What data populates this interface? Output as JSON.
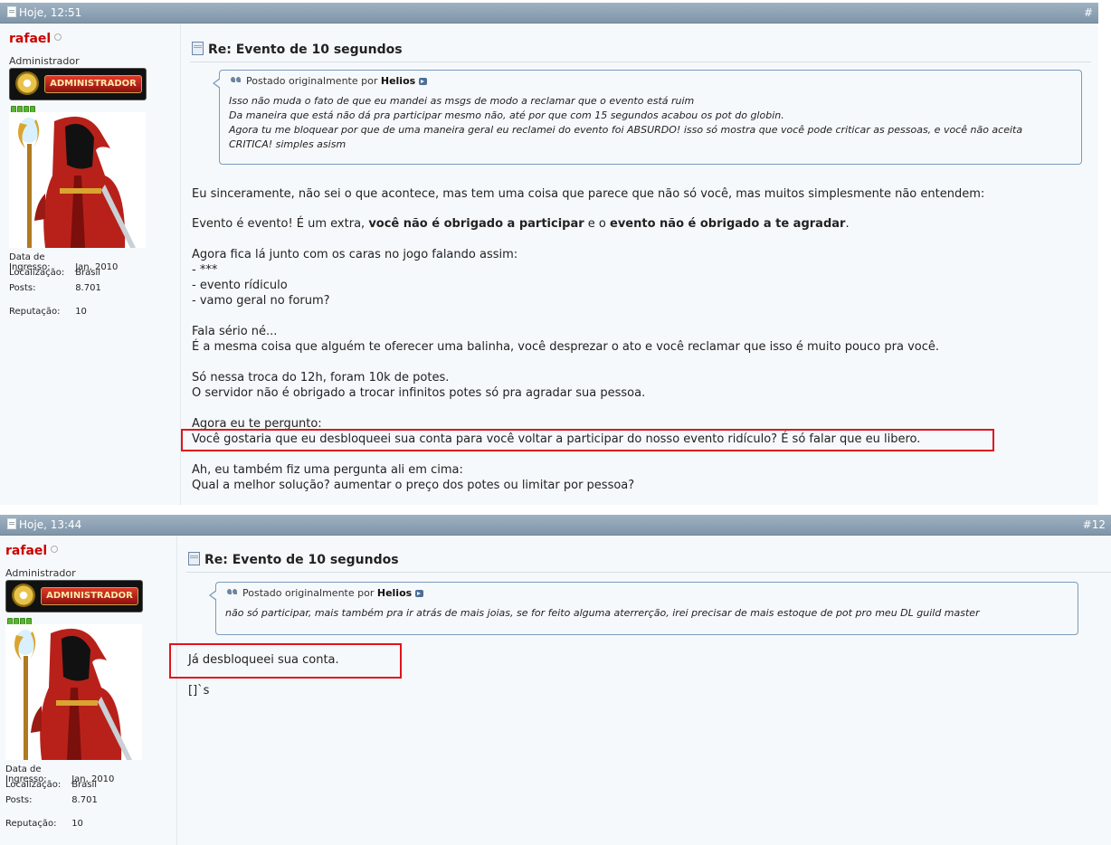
{
  "posts": [
    {
      "header": {
        "date": "Hoje, 12:51",
        "number": "#"
      },
      "user": {
        "name": "rafael",
        "title": "Administrador",
        "rank_label": "ADMINISTRADOR",
        "info": [
          {
            "key": "Data de Ingresso:",
            "value": "Jan, 2010"
          },
          {
            "key": "Localização:",
            "value": "Brasil"
          },
          {
            "key": "Posts:",
            "value": "8.701"
          },
          {
            "key": "Reputação:",
            "value": "10"
          }
        ]
      },
      "title": "Re: Evento de 10 segundos",
      "quote": {
        "prefix": "Postado originalmente por",
        "author": "Helios",
        "lines": [
          "Isso não muda o fato de que eu mandei as msgs de modo a reclamar que o evento está ruim",
          "Da maneira que está não dá pra participar mesmo não, até por que com 15 segundos acabou os pot do globin.",
          "Agora tu me bloquear por que de uma maneira geral eu reclamei do evento foi ABSURDO! isso só mostra que você pode criticar as pessoas, e você não aceita",
          "CRITICA! simples asism"
        ]
      },
      "body": {
        "p1": "Eu sinceramente, não sei o que acontece, mas tem uma coisa que parece que não só você, mas muitos simplesmente não entendem:",
        "p2a": "Evento é evento! É um extra, ",
        "p2b": "você não é obrigado a participar",
        "p2c": " e o ",
        "p2d": "evento não é obrigado a te agradar",
        "p2e": ".",
        "p3": [
          "Agora fica lá junto com os caras no jogo falando assim:",
          "- ***",
          "- evento rídiculo",
          "- vamo geral no forum?"
        ],
        "p4": [
          "Fala sério né...",
          "É a mesma coisa que alguém te oferecer uma balinha, você desprezar o ato e você reclamar que isso é muito pouco pra você."
        ],
        "p5": [
          "Só nessa troca do 12h, foram 10k de potes.",
          "O servidor não é obrigado a trocar infinitos potes só pra agradar sua pessoa."
        ],
        "p6": [
          "Agora eu te pergunto:",
          "Você gostaria que eu desbloqueei sua conta para você voltar a participar do nosso evento ridículo? É só falar que eu libero."
        ],
        "p7": [
          "Ah, eu também fiz uma pergunta ali em cima:",
          "Qual a melhor solução? aumentar o preço dos potes ou limitar por pessoa?"
        ]
      }
    },
    {
      "header": {
        "date": "Hoje, 13:44",
        "number": "#12"
      },
      "user": {
        "name": "rafael",
        "title": "Administrador",
        "rank_label": "ADMINISTRADOR",
        "info": [
          {
            "key": "Data de Ingresso:",
            "value": "Jan, 2010"
          },
          {
            "key": "Localização:",
            "value": "Brasil"
          },
          {
            "key": "Posts:",
            "value": "8.701"
          },
          {
            "key": "Reputação:",
            "value": "10"
          }
        ]
      },
      "title": "Re: Evento de 10 segundos",
      "quote": {
        "prefix": "Postado originalmente por",
        "author": "Helios",
        "lines": [
          "não só participar, mais também pra ir atrás de mais joias, se for feito alguma aterrerção, irei precisar de mais estoque de pot pro meu DL guild master"
        ]
      },
      "body": {
        "p1": "Já desbloqueei sua conta.",
        "p2": "[]`s"
      }
    }
  ],
  "colors": {
    "header_bar": "#8fa3b6",
    "username": "#cc0000",
    "highlight_box": "#e0141e",
    "quote_border": "#7a9bbd"
  }
}
